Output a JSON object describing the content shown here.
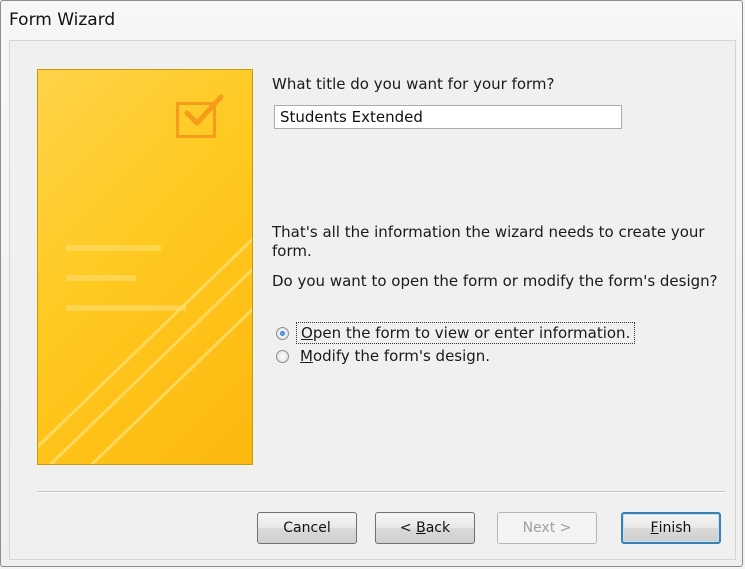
{
  "window": {
    "title": "Form Wizard"
  },
  "wizard": {
    "title_prompt": "What title do you want for your form?",
    "title_value": "Students Extended",
    "info_line1": "That's all the information the wizard needs to create your",
    "info_line2": "form.",
    "question": "Do you want to open the form or modify the form's design?",
    "options": [
      {
        "label_accel": "O",
        "label_rest": "pen the form to view or enter information.",
        "selected": true
      },
      {
        "label_accel": "M",
        "label_rest": "odify the form's design.",
        "selected": false
      }
    ]
  },
  "buttons": {
    "cancel": "Cancel",
    "back_prefix": "< ",
    "back_accel": "B",
    "back_rest": "ack",
    "next": "Next >",
    "finish_accel": "F",
    "finish_rest": "inish"
  },
  "colors": {
    "banner_yellow": "#ffc91f",
    "banner_border": "#c69b0e",
    "check_orange": "#f59c1a",
    "default_button_border": "#3c7fb1"
  },
  "icons": [
    "checkbox-check-icon"
  ]
}
